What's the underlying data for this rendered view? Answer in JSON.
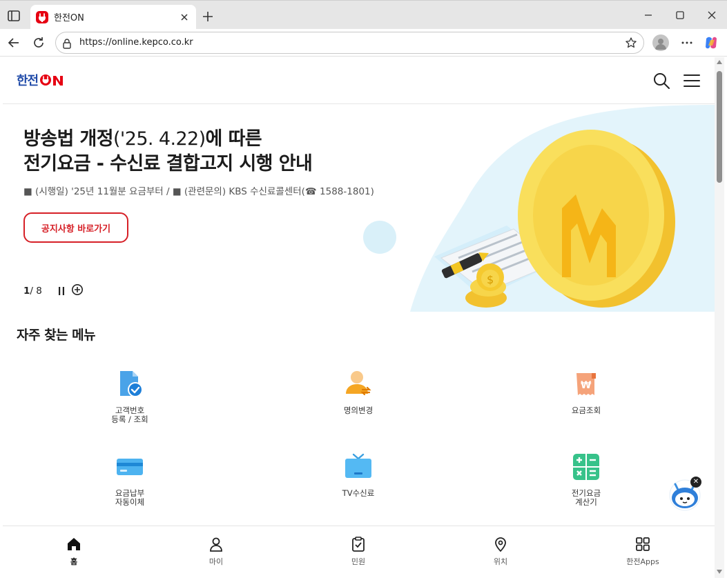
{
  "browser": {
    "tab_title": "한전ON",
    "url": "https://online.kepco.co.kr"
  },
  "site": {
    "logo_text": "한전",
    "logo_on": "ON"
  },
  "hero": {
    "title_line1_bold_a": "방송법 개정",
    "title_line1_light": "('25. 4.22)",
    "title_line1_bold_b": "에 따른",
    "title_line2": "전기요금 - 수신료 결합고지 시행 안내",
    "subtitle": "■ (시행일) '25년 11월분 요금부터 / ■ (관련문의) KBS 수신료콜센터(☎ 1588-1801)",
    "button_label": "공지사항 바로가기",
    "pager_current": "1",
    "pager_total": "/ 8"
  },
  "frequent_menu": {
    "title": "자주 찾는 메뉴",
    "items": [
      {
        "label": "고객번호\n등록 / 조회",
        "icon": "document-check-icon"
      },
      {
        "label": "명의변경",
        "icon": "person-change-icon"
      },
      {
        "label": "요금조회",
        "icon": "bill-won-icon"
      },
      {
        "label": "요금납부\n자동이체",
        "icon": "credit-card-icon"
      },
      {
        "label": "TV수신료",
        "icon": "tv-icon"
      },
      {
        "label": "전기요금\n계산기",
        "icon": "calculator-icon"
      }
    ]
  },
  "bottom_nav": {
    "items": [
      {
        "label": "홈",
        "icon": "home-icon"
      },
      {
        "label": "마이",
        "icon": "person-icon"
      },
      {
        "label": "민원",
        "icon": "clipboard-check-icon"
      },
      {
        "label": "위치",
        "icon": "location-pin-icon"
      },
      {
        "label": "한전Apps",
        "icon": "apps-grid-icon"
      }
    ]
  },
  "colors": {
    "brand_red": "#d61f26",
    "brand_blue": "#1f4aa8",
    "hero_bg_blue": "#e3f4fb",
    "coin_yellow": "#f7d54a"
  }
}
